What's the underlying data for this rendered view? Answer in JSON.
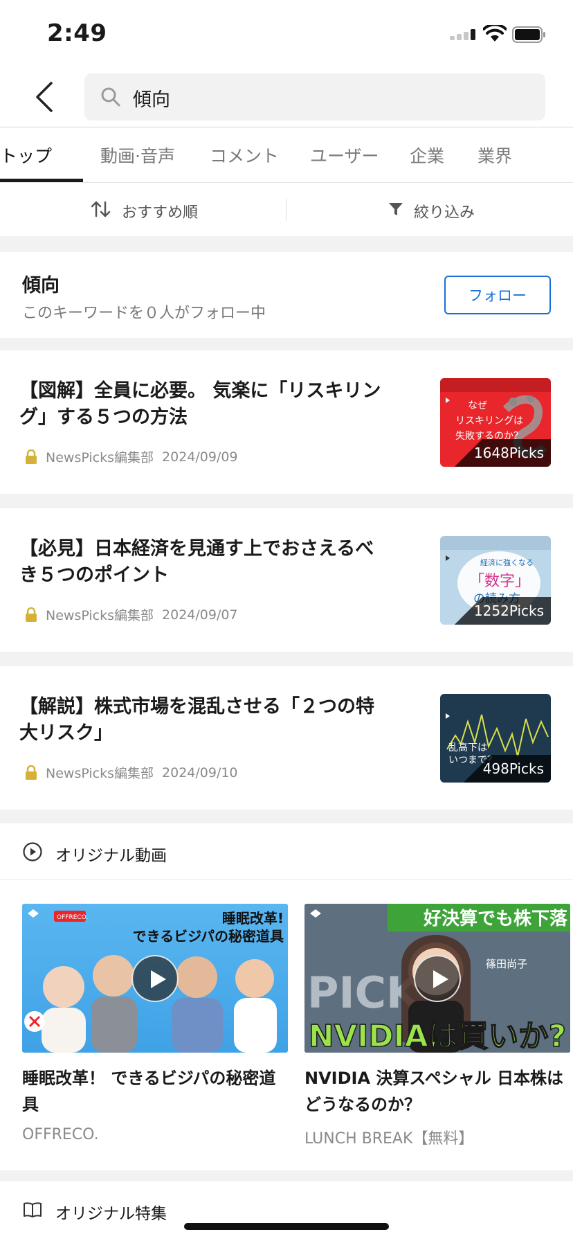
{
  "status_bar": {
    "time": "2:49"
  },
  "search": {
    "query": "傾向"
  },
  "tabs": [
    {
      "label": "トップ",
      "active": true
    },
    {
      "label": "動画·音声",
      "active": false
    },
    {
      "label": "コメント",
      "active": false
    },
    {
      "label": "ユーザー",
      "active": false
    },
    {
      "label": "企業",
      "active": false
    },
    {
      "label": "業界",
      "active": false
    }
  ],
  "sortbar": {
    "sort_label": "おすすめ順",
    "filter_label": "絞り込み"
  },
  "keyword": {
    "title": "傾向",
    "followers_text": "このキーワードを０人がフォロー中",
    "follow_label": "フォロー"
  },
  "articles": [
    {
      "title": "【図解】全員に必要。 気楽に「リスキリング」する５つの方法",
      "author": "NewsPicks編集部",
      "date": "2024/09/09",
      "picks": "1648Picks",
      "thumb_text": [
        "なぜ",
        "リスキリングは",
        "失敗するのか？"
      ],
      "thumb_color": "#e8262b"
    },
    {
      "title": "【必見】日本経済を見通す上でおさえるべき５つのポイント",
      "author": "NewsPicks編集部",
      "date": "2024/09/07",
      "picks": "1252Picks",
      "thumb_text": [
        "経済に強くなる",
        "「数字」",
        "の読み方"
      ],
      "thumb_color": "#bcd6ea"
    },
    {
      "title": "【解説】株式市場を混乱させる「２つの特大リスク」",
      "author": "NewsPicks編集部",
      "date": "2024/09/10",
      "picks": "498Picks",
      "thumb_text": [
        "乱高下は",
        "いつまで？"
      ],
      "thumb_color": "#1f3a4f"
    }
  ],
  "original_videos": {
    "heading": "オリジナル動画",
    "items": [
      {
        "title": "睡眠改革！ できるビジパの秘密道具",
        "source": "OFFRECO.",
        "thumb_caption_1": "睡眠改革!",
        "thumb_caption_2": "できるビジパの秘密道具",
        "brand": "OFFRECO."
      },
      {
        "title": "NVIDIA 決算スペシャル 日本株はどうなるのか？",
        "source": "LUNCH BREAK【無料】",
        "thumb_caption_1": "好決算でも株下落",
        "thumb_caption_2": "NVIDIAは買いか?",
        "thumb_name": "篠田尚子",
        "thumb_bg_text": "PICK"
      }
    ]
  },
  "original_features": {
    "heading": "オリジナル特集"
  },
  "colors": {
    "accent": "#1a6fd6",
    "lock": "#d4b23a"
  }
}
